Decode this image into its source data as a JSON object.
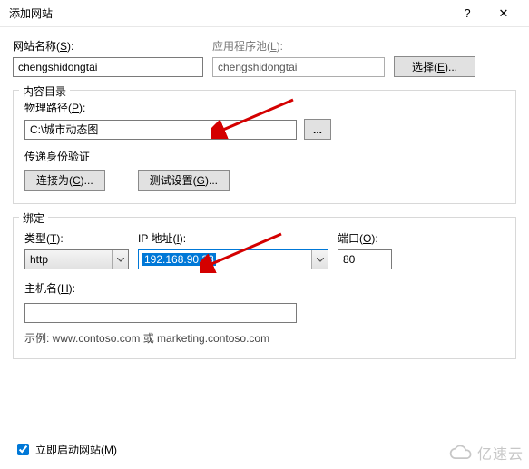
{
  "window": {
    "title": "添加网站",
    "help": "?",
    "close": "✕"
  },
  "top": {
    "site_name_label_pre": "网站名称(",
    "site_name_hotkey": "S",
    "site_name_label_post": "):",
    "site_name_value": "chengshidongtai",
    "app_pool_label_pre": "应用程序池(",
    "app_pool_hotkey": "L",
    "app_pool_label_post": "):",
    "app_pool_value": "chengshidongtai",
    "select_btn_pre": "选择(",
    "select_btn_hotkey": "E",
    "select_btn_post": ")..."
  },
  "content_dir": {
    "legend": "内容目录",
    "phys_label_pre": "物理路径(",
    "phys_hotkey": "P",
    "phys_label_post": "):",
    "phys_value": "C:\\城市动态图",
    "browse": "...",
    "auth_legend": "传递身份验证",
    "connect_btn_pre": "连接为(",
    "connect_btn_hotkey": "C",
    "connect_btn_post": ")...",
    "test_btn_pre": "测试设置(",
    "test_btn_hotkey": "G",
    "test_btn_post": ")..."
  },
  "binding": {
    "legend": "绑定",
    "type_label_pre": "类型(",
    "type_hotkey": "T",
    "type_label_post": "):",
    "type_value": "http",
    "ip_label_pre": "IP 地址(",
    "ip_hotkey": "I",
    "ip_label_post": "):",
    "ip_value": "192.168.90.33",
    "port_label_pre": "端口(",
    "port_hotkey": "O",
    "port_label_post": "):",
    "port_value": "80",
    "host_label_pre": "主机名(",
    "host_hotkey": "H",
    "host_label_post": "):",
    "host_value": "",
    "example": "示例: www.contoso.com 或 marketing.contoso.com"
  },
  "footer": {
    "start_now_pre": "立即启动网站(",
    "start_now_hotkey": "M",
    "start_now_post": ")"
  },
  "watermark": "亿速云"
}
